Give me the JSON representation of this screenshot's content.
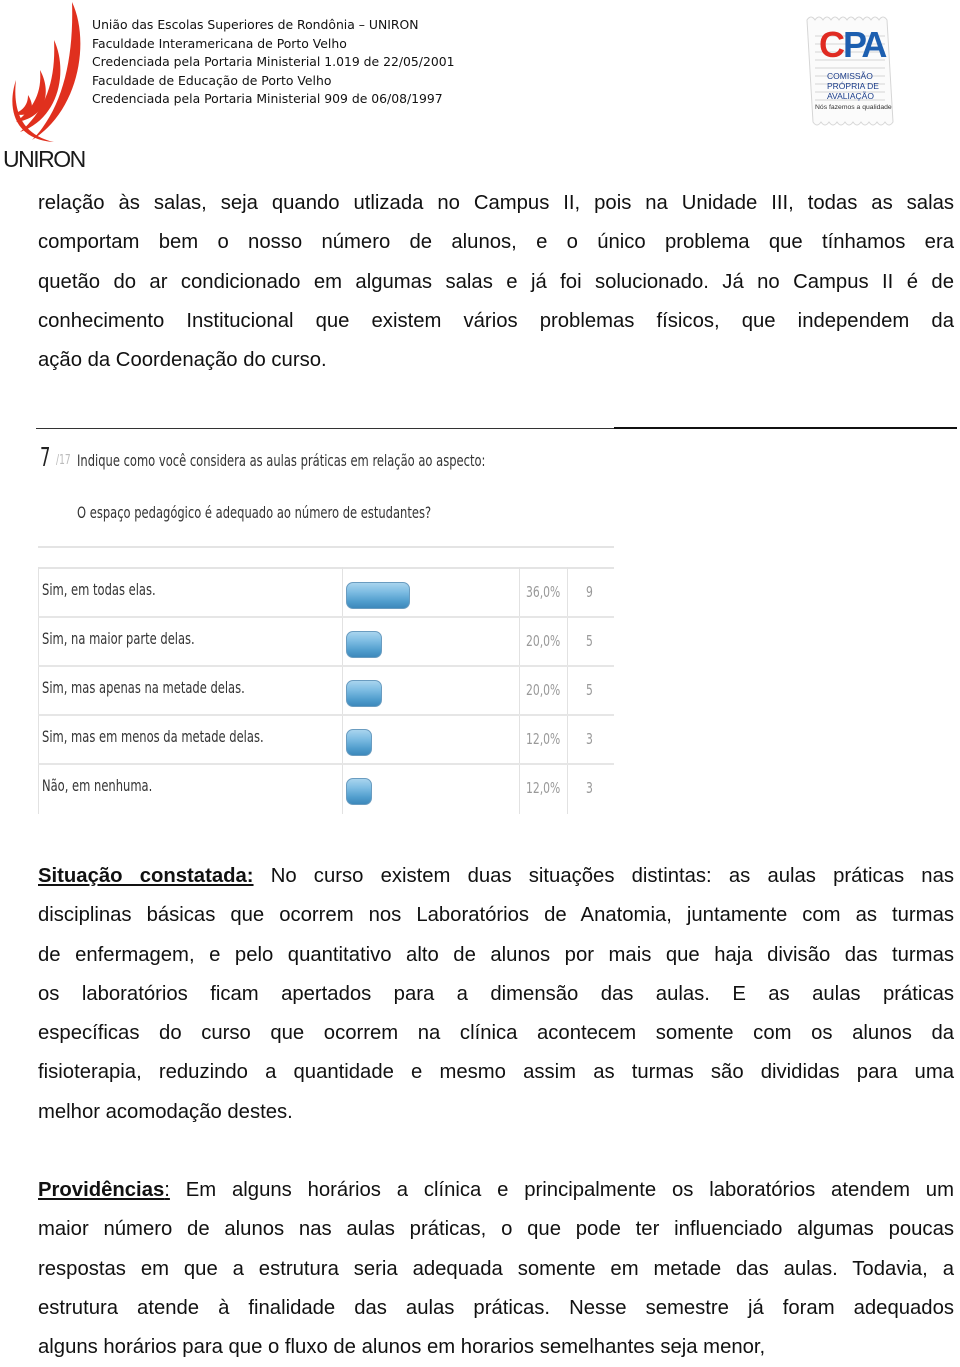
{
  "header": {
    "logo_text": "UNIRON",
    "lines": [
      "União das Escolas Superiores de Rondônia – UNIRON",
      "Faculdade Interamericana de Porto Velho",
      "Credenciada pela Portaria Ministerial 1.019 de 22/05/2001",
      "Faculdade de Educação de Porto Velho",
      "Credenciada pela Portaria Ministerial 909 de 06/08/1997"
    ],
    "cpa_logo": {
      "acronym_c": "C",
      "acronym_pa": "PA",
      "lines": [
        "Comissão",
        "Própria de",
        "Avaliação"
      ],
      "tagline": "Nós fazemos a qualidade"
    }
  },
  "intro_paragraph": {
    "lines": [
      "relação às salas, seja quando utlizada no Campus II, pois na Unidade III, todas as salas",
      "comportam bem o nosso número de alunos, e  o único problema que  tínhamos era",
      "quetão do ar condicionado em algumas salas e já foi solucionado. Já no Campus II é de",
      "conhecimento Institucional que existem vários problemas físicos, que independem da",
      "ação da Coordenação do curso."
    ]
  },
  "survey": {
    "question_number": "7",
    "question_total": "/17",
    "question_text": "Indique como você considera as aulas práticas em relação ao aspecto:",
    "question_subtext": "O espaço pedagógico é adequado ao número de estudantes?",
    "bar_color": "#5aa5d3"
  },
  "chart_data": {
    "type": "bar",
    "orientation": "horizontal",
    "title": "Indique como você considera as aulas práticas em relação ao aspecto: O espaço pedagógico é adequado ao número de estudantes?",
    "categories": [
      "Sim, em todas elas.",
      "Sim, na maior parte delas.",
      "Sim, mas apenas na metade delas.",
      "Sim, mas em menos da metade delas.",
      "Não, em nenhuma."
    ],
    "values": [
      36.0,
      20.0,
      20.0,
      12.0,
      12.0
    ],
    "percent_labels": [
      "36,0%",
      "20,0%",
      "20,0%",
      "12,0%",
      "12,0%"
    ],
    "counts": [
      9,
      5,
      5,
      3,
      3
    ],
    "count_labels": [
      "9",
      "5",
      "5",
      "3",
      "3"
    ],
    "xlabel": "",
    "ylabel": "",
    "xlim": [
      0,
      100
    ],
    "grid": false,
    "legend": "none"
  },
  "situacao": {
    "label": "Situação constatada:",
    "lines": [
      " No curso existem duas situações distintas: as aulas práticas nas",
      "disciplinas básicas que ocorrem nos Laboratórios de Anatomia, juntamente com as turmas",
      "de enfermagem, e pelo quantitativo alto de alunos por mais que haja divisão das turmas",
      "os laboratórios ficam apertados para a dimensão das aulas. E as aulas práticas",
      "específicas do curso que ocorrem na clínica acontecem somente com os alunos da",
      "fisioterapia, reduzindo a quantidade e mesmo assim as turmas são divididas para uma",
      "melhor acomodação destes."
    ]
  },
  "providencias": {
    "label": "Providências",
    "colon": ":",
    "lines": [
      " Em alguns horários a clínica e principalmente os laboratórios atendem um",
      "maior número de alunos nas aulas práticas, o que pode ter influenciado algumas poucas",
      "respostas em que a estrutura seria adequada somente em metade das aulas. Todavia, a",
      "estrutura atende à finalidade das aulas práticas. Nesse semestre já foram adequados",
      "alguns horários para que o fluxo de alunos em horarios semelhantes seja menor,"
    ]
  }
}
